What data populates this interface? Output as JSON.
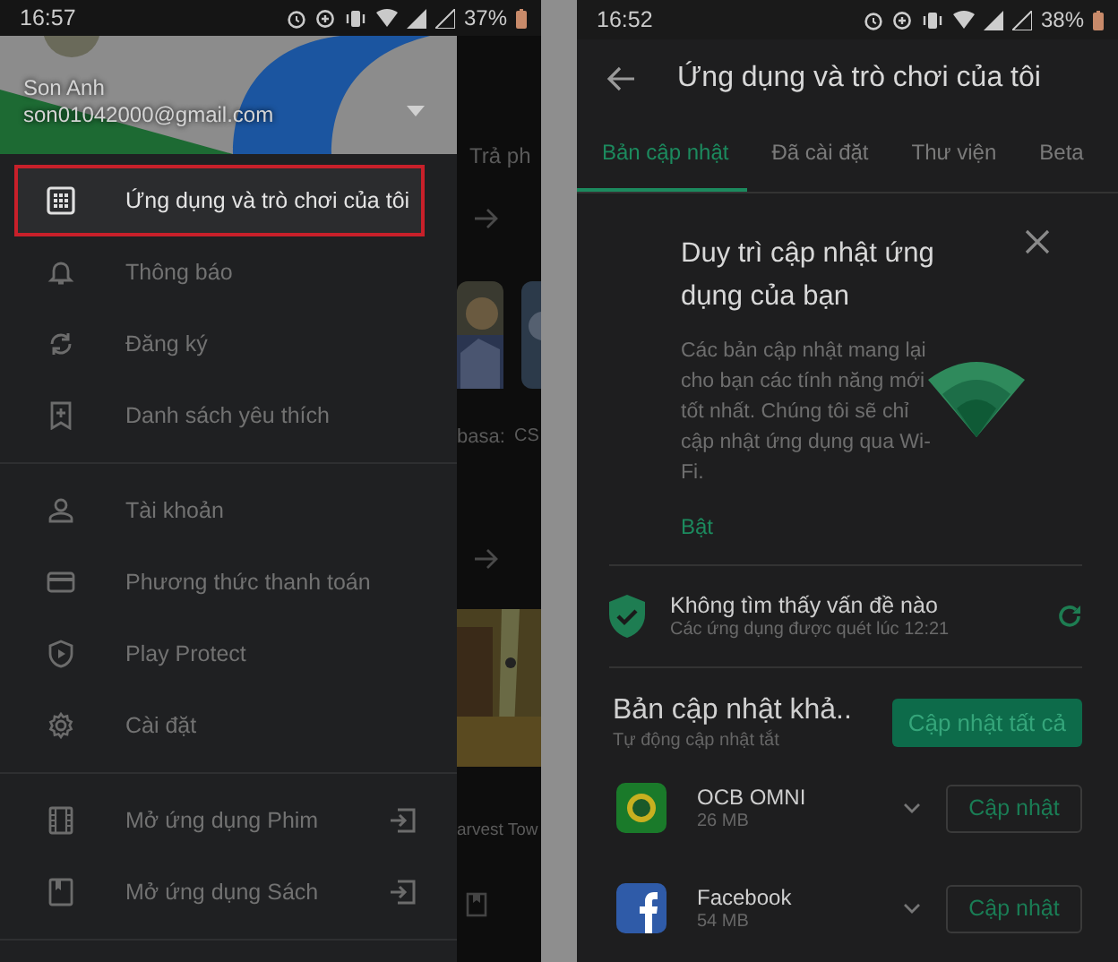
{
  "left_phone": {
    "status_bar": {
      "time": "16:57",
      "battery": "37%"
    },
    "account": {
      "name": "Son Anh",
      "email": "son01042000@gmail.com"
    },
    "menu_sections": [
      [
        {
          "label": "Ứng dụng và trò chơi của tôi",
          "selected": true,
          "kind": "plain"
        },
        {
          "label": "Thông báo",
          "selected": false,
          "kind": "plain"
        },
        {
          "label": "Đăng ký",
          "selected": false,
          "kind": "plain"
        },
        {
          "label": "Danh sách yêu thích",
          "selected": false,
          "kind": "plain"
        }
      ],
      [
        {
          "label": "Tài khoản",
          "selected": false,
          "kind": "plain"
        },
        {
          "label": "Phương thức thanh toán",
          "selected": false,
          "kind": "plain"
        },
        {
          "label": "Play Protect",
          "selected": false,
          "kind": "plain"
        },
        {
          "label": "Cài đặt",
          "selected": false,
          "kind": "plain"
        }
      ],
      [
        {
          "label": "Mở ứng dụng Phim",
          "selected": false,
          "kind": "app_link"
        },
        {
          "label": "Mở ứng dụng Sách",
          "selected": false,
          "kind": "app_link"
        }
      ]
    ],
    "behind": {
      "tab": "Trả ph",
      "game_caption": "basa:",
      "game_caption_2": "CS",
      "game_title": "arvest Tow"
    }
  },
  "right_phone": {
    "status_bar": {
      "time": "16:52",
      "battery": "38%"
    },
    "title": "Ứng dụng và trò chơi của tôi",
    "tabs": [
      {
        "label": "Bản cập nhật",
        "selected": true
      },
      {
        "label": "Đã cài đặt",
        "selected": false
      },
      {
        "label": "Thư viện",
        "selected": false
      },
      {
        "label": "Beta",
        "selected": false
      }
    ],
    "promo": {
      "title": "Duy trì cập nhật ứng dụng của bạn",
      "body": "Các bản cập nhật mang lại cho bạn các tính năng mới tốt nhất. Chúng tôi sẽ chỉ cập nhật ứng dụng qua Wi-Fi.",
      "action": "Bật"
    },
    "protect": {
      "title": "Không tìm thấy vấn đề nào",
      "subtitle": "Các ứng dụng được quét lúc 12:21"
    },
    "updates": {
      "title": "Bản cập nhật khả..",
      "subtitle": "Tự động cập nhật tắt",
      "button": "Cập nhật tất cả",
      "apps": [
        {
          "name": "OCB OMNI",
          "size": "26 MB",
          "button": "Cập nhật"
        },
        {
          "name": "Facebook",
          "size": "54 MB",
          "button": "Cập nhật"
        }
      ]
    }
  }
}
